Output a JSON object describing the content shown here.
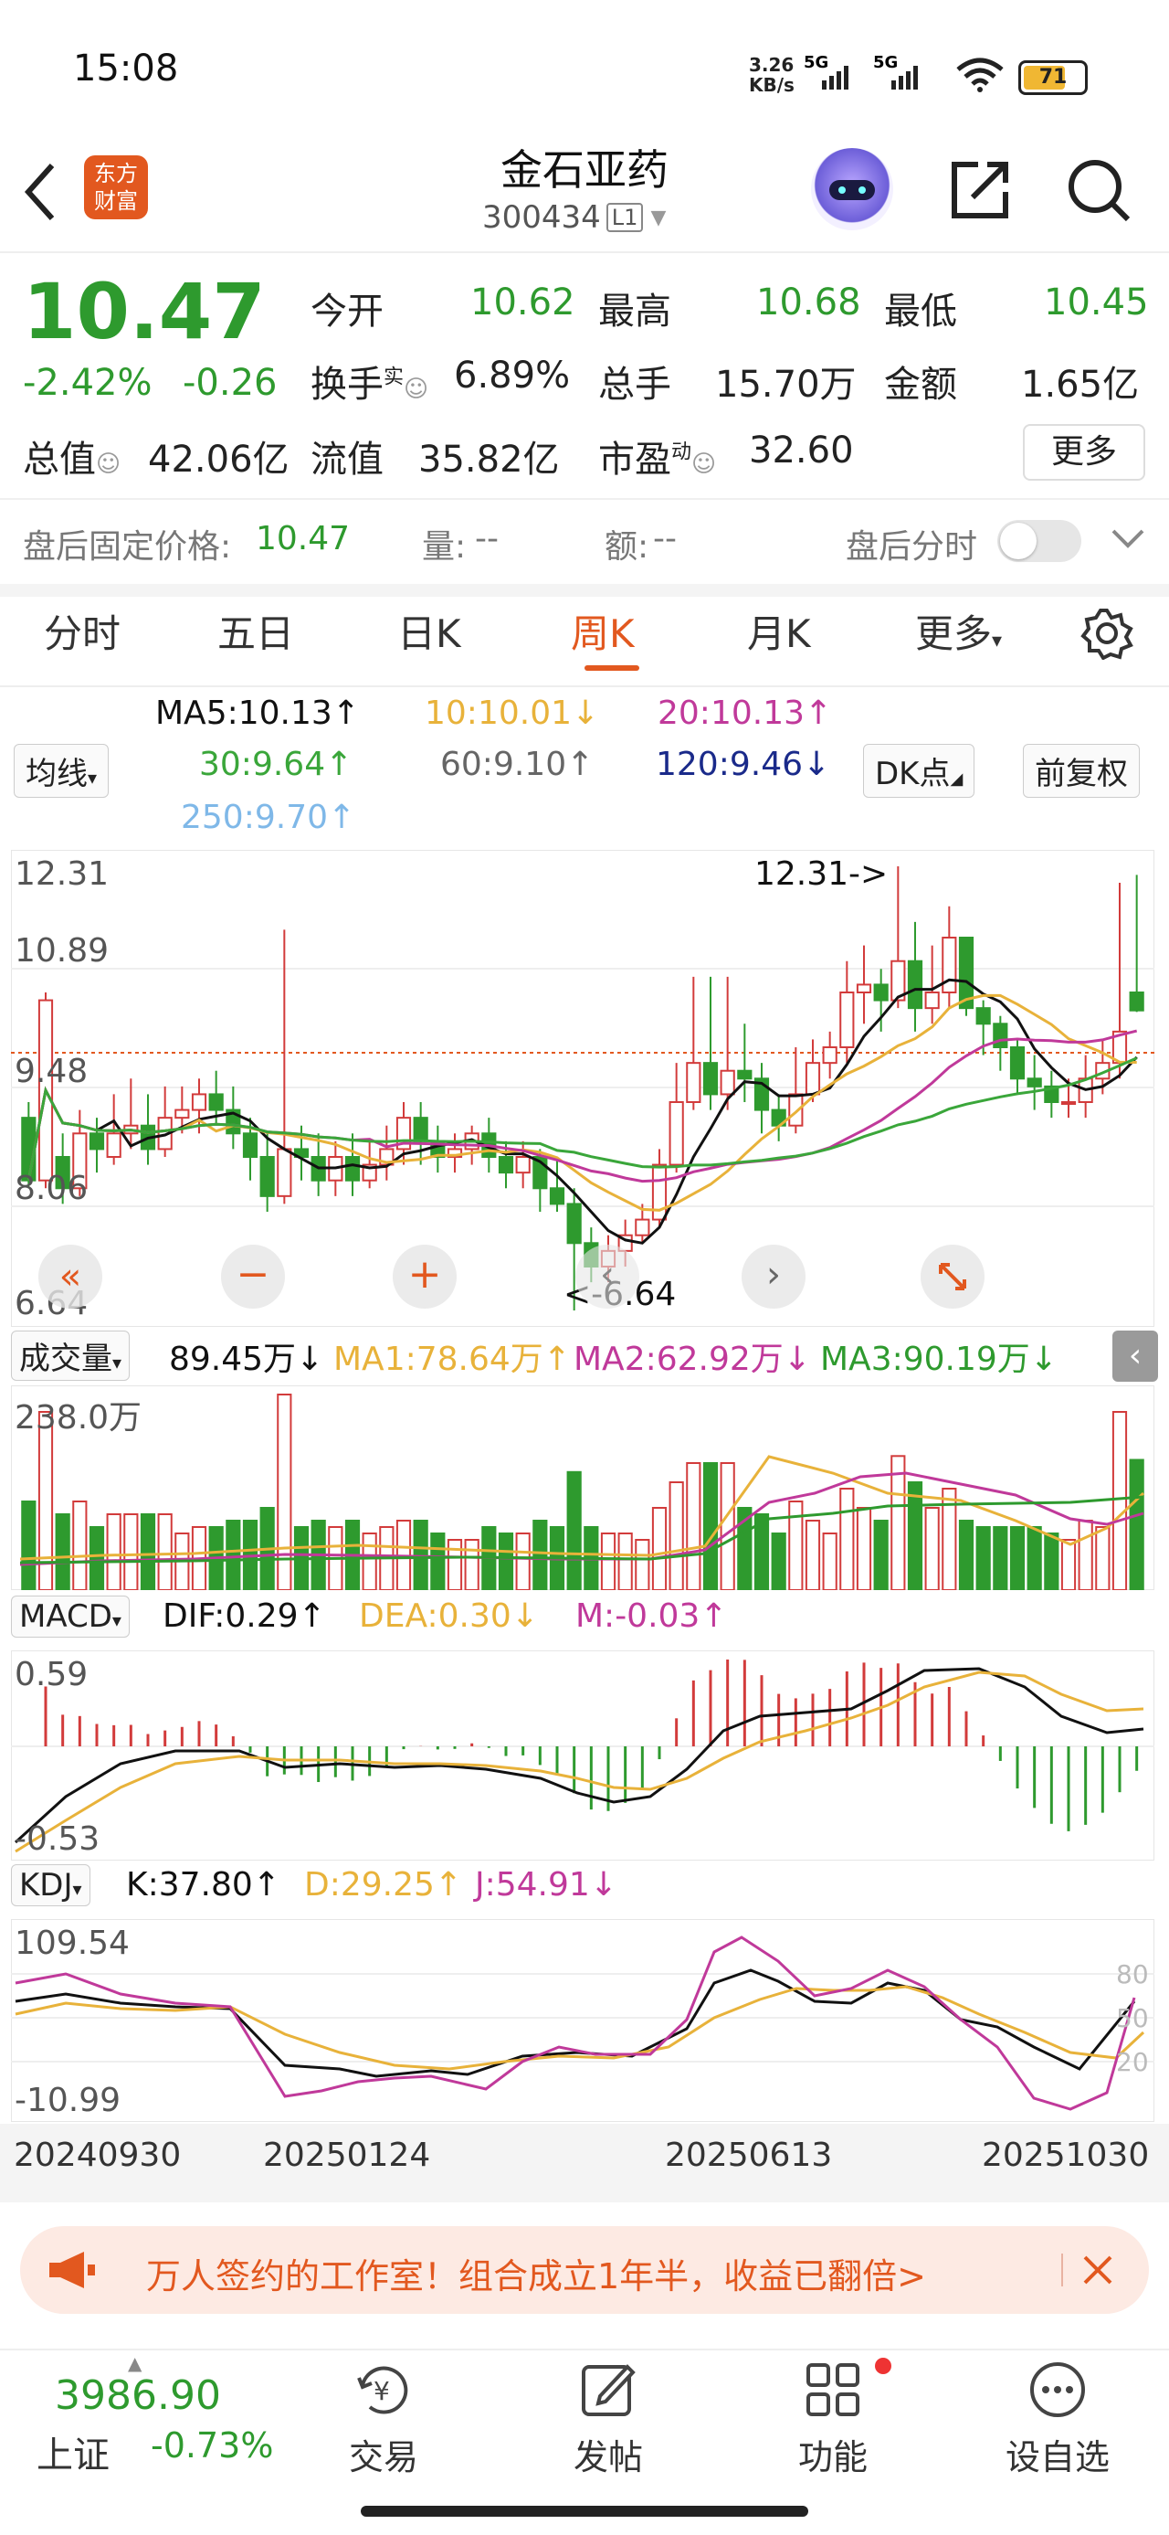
{
  "status_bar": {
    "time": "15:08",
    "net_speed_top": "3.26",
    "net_speed_bottom": "KB/s",
    "signal1": "5G",
    "signal2": "5G",
    "battery": "71"
  },
  "header": {
    "logo_text": [
      "东方",
      "财富"
    ],
    "title": "金石亚药",
    "code": "300434",
    "level": "L1"
  },
  "quote": {
    "price": "10.47",
    "pct": "-2.42%",
    "chg": "-0.26",
    "open_label": "今开",
    "open": "10.62",
    "high_label": "最高",
    "high": "10.68",
    "low_label": "最低",
    "low": "10.45",
    "turnover_label": "换手",
    "turnover_sup": "实",
    "turnover": "6.89%",
    "volume_label": "总手",
    "volume": "15.70万",
    "amount_label": "金额",
    "amount": "1.65亿",
    "mcap_label": "总值",
    "mcap": "42.06亿",
    "float_label": "流值",
    "float": "35.82亿",
    "pe_label": "市盈",
    "pe_sup": "动",
    "pe": "32.60",
    "more": "更多"
  },
  "after_hours": {
    "fixed_label": "盘后固定价格:",
    "fixed_value": "10.47",
    "vol_label": "量:",
    "vol": "--",
    "amt_label": "额:",
    "amt": "--",
    "toggle_label": "盘后分时"
  },
  "tabs": [
    "分时",
    "五日",
    "日K",
    "周K",
    "月K",
    "更多"
  ],
  "active_tab": 3,
  "ma_legend": {
    "selector": "均线",
    "ma5": "MA5:10.13",
    "ma10": "10:10.01",
    "ma20": "20:10.13",
    "ma30": "30:9.64",
    "ma60": "60:9.10",
    "ma120": "120:9.46",
    "ma250": "250:9.70",
    "dk": "DK点",
    "fq": "前复权"
  },
  "colors": {
    "up": "#d23b3b",
    "down": "#2e9a2e",
    "ma5": "#111111",
    "ma10": "#e8b23a",
    "ma20": "#c0399a",
    "ma30": "#3aa63a",
    "ma60": "#666666",
    "ma120": "#1a2a8a",
    "ma250": "#7fb8e8",
    "accent": "#e2581f"
  },
  "price_axis": {
    "top": "12.31",
    "mid1": "10.89",
    "mid2": "9.48",
    "mid3": "8.06",
    "bottom": "6.64",
    "max_marker": "12.31->",
    "min_marker": "<-6.64"
  },
  "volume_legend": {
    "selector": "成交量",
    "value": "89.45万",
    "ma1": "MA1:78.64万",
    "ma2": "MA2:62.92万",
    "ma3": "MA3:90.19万",
    "axis_top": "238.0万"
  },
  "macd_legend": {
    "selector": "MACD",
    "dif": "DIF:0.29",
    "dea": "DEA:0.30",
    "m": "M:-0.03",
    "axis_top": "0.59",
    "axis_bottom": "-0.53"
  },
  "kdj_legend": {
    "selector": "KDJ",
    "k": "K:37.80",
    "d": "D:29.25",
    "j": "J:54.91",
    "axis_top": "109.54",
    "axis_bottom": "-10.99",
    "ref80": "80",
    "ref50": "50",
    "ref20": "20"
  },
  "dates": [
    "20240930",
    "20250124",
    "20250613",
    "20251030"
  ],
  "banner": {
    "text": "万人签约的工作室！组合成立1年半，收益已翻倍>"
  },
  "footer": {
    "index_value": "3986.90",
    "index_name": "上证",
    "index_pct": "-0.73%",
    "trade": "交易",
    "post": "发帖",
    "features": "功能",
    "watch": "设自选"
  },
  "chart_data": {
    "type": "candlestick",
    "period": "weekly",
    "ylim": [
      6.64,
      12.31
    ],
    "candles": [
      [
        9.1,
        8.3,
        9.3,
        8.2
      ],
      [
        8.3,
        10.6,
        10.7,
        8.2
      ],
      [
        8.6,
        8.2,
        8.9,
        8.0
      ],
      [
        8.2,
        8.9,
        9.2,
        8.1
      ],
      [
        8.9,
        8.7,
        9.1,
        8.4
      ],
      [
        8.6,
        8.9,
        9.4,
        8.5
      ],
      [
        8.9,
        9.0,
        9.6,
        8.7
      ],
      [
        9.0,
        8.7,
        9.4,
        8.5
      ],
      [
        8.7,
        9.1,
        9.5,
        8.6
      ],
      [
        9.1,
        9.2,
        9.5,
        8.9
      ],
      [
        9.2,
        9.4,
        9.6,
        8.9
      ],
      [
        9.4,
        9.2,
        9.7,
        9.0
      ],
      [
        9.2,
        8.9,
        9.5,
        8.7
      ],
      [
        8.9,
        8.6,
        9.1,
        8.3
      ],
      [
        8.6,
        8.1,
        8.9,
        7.9
      ],
      [
        8.1,
        8.7,
        11.5,
        8.0
      ],
      [
        8.7,
        8.6,
        9.0,
        8.3
      ],
      [
        8.6,
        8.3,
        8.9,
        8.1
      ],
      [
        8.3,
        8.6,
        8.8,
        8.1
      ],
      [
        8.6,
        8.3,
        8.9,
        8.1
      ],
      [
        8.3,
        8.5,
        8.8,
        8.2
      ],
      [
        8.5,
        8.7,
        9.0,
        8.3
      ],
      [
        8.7,
        9.1,
        9.3,
        8.5
      ],
      [
        9.1,
        8.8,
        9.3,
        8.5
      ],
      [
        8.8,
        8.6,
        9.0,
        8.4
      ],
      [
        8.6,
        8.7,
        8.9,
        8.4
      ],
      [
        8.7,
        8.9,
        9.0,
        8.5
      ],
      [
        8.9,
        8.6,
        9.1,
        8.4
      ],
      [
        8.6,
        8.4,
        8.8,
        8.2
      ],
      [
        8.4,
        8.6,
        8.8,
        8.2
      ],
      [
        8.6,
        8.2,
        8.7,
        7.9
      ],
      [
        8.2,
        8.0,
        8.6,
        7.9
      ],
      [
        8.0,
        7.5,
        8.2,
        6.64
      ],
      [
        7.5,
        7.2,
        7.7,
        7.0
      ],
      [
        7.2,
        7.4,
        7.6,
        7.0
      ],
      [
        7.4,
        7.6,
        7.8,
        7.2
      ],
      [
        7.6,
        7.8,
        8.0,
        7.5
      ],
      [
        7.8,
        8.5,
        8.7,
        7.7
      ],
      [
        8.5,
        9.3,
        9.8,
        8.4
      ],
      [
        9.3,
        9.8,
        10.9,
        9.2
      ],
      [
        9.8,
        9.4,
        10.9,
        9.2
      ],
      [
        9.4,
        9.7,
        10.9,
        9.2
      ],
      [
        9.7,
        9.6,
        10.3,
        9.3
      ],
      [
        9.6,
        9.2,
        9.8,
        8.9
      ],
      [
        9.2,
        9.0,
        9.4,
        8.8
      ],
      [
        9.0,
        9.4,
        10.0,
        8.9
      ],
      [
        9.4,
        9.8,
        10.1,
        9.3
      ],
      [
        9.8,
        10.0,
        10.2,
        9.6
      ],
      [
        10.0,
        10.7,
        11.1,
        9.8
      ],
      [
        10.7,
        10.8,
        11.3,
        10.3
      ],
      [
        10.8,
        10.6,
        11.0,
        10.2
      ],
      [
        10.6,
        11.1,
        12.31,
        10.5
      ],
      [
        11.1,
        10.5,
        11.6,
        10.2
      ],
      [
        10.5,
        10.7,
        11.3,
        10.3
      ],
      [
        10.7,
        11.4,
        11.8,
        10.5
      ],
      [
        11.4,
        10.5,
        11.2,
        10.4
      ],
      [
        10.5,
        10.3,
        10.6,
        9.9
      ],
      [
        10.3,
        10.0,
        10.4,
        9.7
      ],
      [
        10.0,
        9.6,
        10.1,
        9.4
      ],
      [
        9.6,
        9.5,
        9.9,
        9.2
      ],
      [
        9.5,
        9.3,
        9.7,
        9.1
      ],
      [
        9.3,
        9.3,
        9.6,
        9.1
      ],
      [
        9.3,
        9.6,
        9.9,
        9.1
      ],
      [
        9.6,
        9.8,
        10.1,
        9.4
      ],
      [
        9.8,
        10.2,
        12.1,
        9.6
      ],
      [
        10.7,
        10.47,
        12.2,
        10.45
      ]
    ]
  }
}
